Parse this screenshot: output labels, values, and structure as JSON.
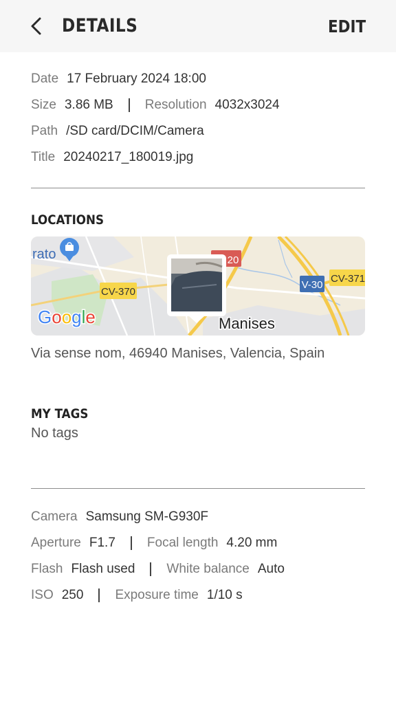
{
  "header": {
    "title": "DETAILS",
    "edit_label": "EDIT"
  },
  "file_info": {
    "date_label": "Date",
    "date_value": "17 February 2024 18:00",
    "size_label": "Size",
    "size_value": "3.86 MB",
    "resolution_label": "Resolution",
    "resolution_value": "4032x3024",
    "path_label": "Path",
    "path_value": "/SD card/DCIM/Camera",
    "title_label": "Title",
    "title_value": "20240217_180019.jpg"
  },
  "locations": {
    "heading": "LOCATIONS",
    "map": {
      "labels": {
        "poi_partial": "rato",
        "road_cv370": "CV-370",
        "road_a20_partial": "20",
        "road_v30": "V-30",
        "road_cv371": "CV-371",
        "town": "Manises",
        "provider": "Google"
      },
      "colors": {
        "land": "#f2ecdd",
        "green": "#cfe6c6",
        "grey": "#e3e4e6",
        "highway": "#f5c94a",
        "yellow_badge": "#f7d64a",
        "blue_badge": "#3f6fb3",
        "red_badge": "#d95b55",
        "poi": "#4a8de0"
      }
    },
    "address": "Via sense nom, 46940 Manises, Valencia, Spain"
  },
  "tags": {
    "heading": "MY TAGS",
    "empty_text": "No tags"
  },
  "camera_info": {
    "camera_label": "Camera",
    "camera_value": "Samsung SM-G930F",
    "aperture_label": "Aperture",
    "aperture_value": "F1.7",
    "focal_label": "Focal length",
    "focal_value": "4.20 mm",
    "flash_label": "Flash",
    "flash_value": "Flash used",
    "wb_label": "White balance",
    "wb_value": "Auto",
    "iso_label": "ISO",
    "iso_value": "250",
    "exposure_label": "Exposure time",
    "exposure_value": "1/10 s"
  }
}
